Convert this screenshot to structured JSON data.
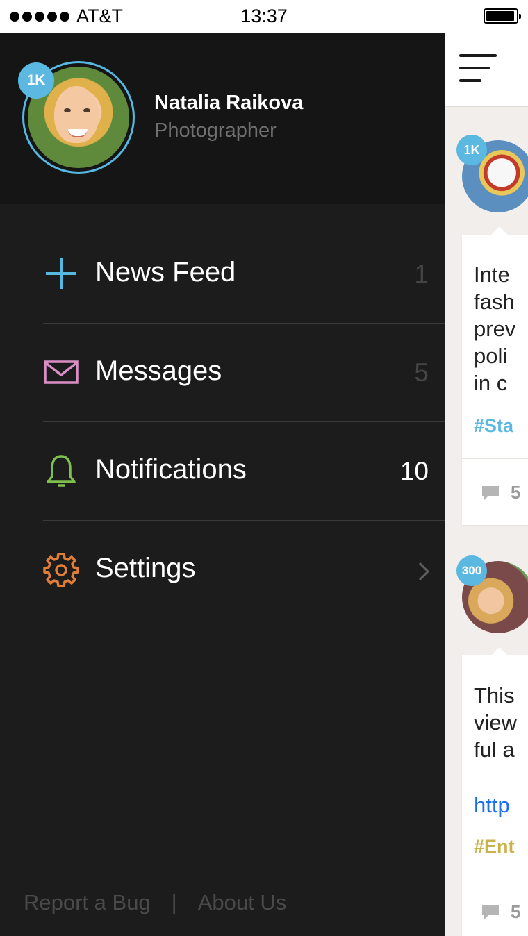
{
  "status_bar": {
    "carrier": "AT&T",
    "time": "13:37"
  },
  "profile": {
    "name": "Natalia Raikova",
    "role": "Photographer",
    "badge": "1K"
  },
  "menu": [
    {
      "label": "News Feed",
      "count": "1",
      "icon": "plus-icon",
      "color": "#56b7e1"
    },
    {
      "label": "Messages",
      "count": "5",
      "icon": "mail-icon",
      "color": "#d98fc6"
    },
    {
      "label": "Notifications",
      "count": "10",
      "icon": "bell-icon",
      "color": "#7ec04b"
    },
    {
      "label": "Settings",
      "count": "",
      "icon": "gear-icon",
      "color": "#e27d38"
    }
  ],
  "footer": {
    "report": "Report a Bug",
    "separator": "|",
    "about": "About Us"
  },
  "feed": {
    "posts": [
      {
        "badge": "1K",
        "text": "Inte\nfash\nprev\npoli\nin c",
        "tag": "#Sta",
        "tag_color": "#5bb8e0",
        "comments": "5"
      },
      {
        "badge": "300",
        "text": "This\nview\nful a",
        "link": "http",
        "tag": "#Ent",
        "tag_color": "#c9b24a",
        "comments": "5"
      }
    ]
  },
  "colors": {
    "accent": "#56b7e1",
    "sidebar_bg": "#1c1c1c"
  }
}
